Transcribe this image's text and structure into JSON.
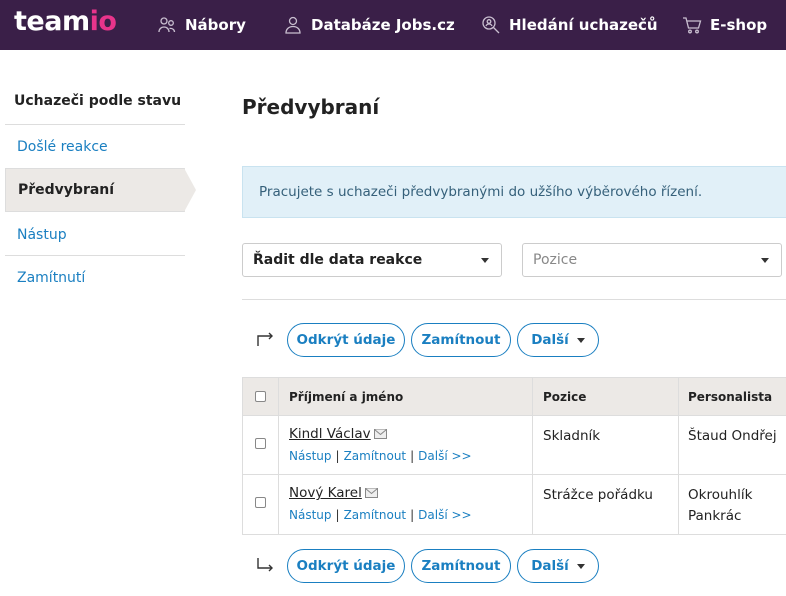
{
  "brand": {
    "logo_main": "team",
    "logo_accent": "io"
  },
  "nav": {
    "items": [
      {
        "label": "Nábory",
        "icon": "people-icon"
      },
      {
        "label": "Databáze Jobs.cz",
        "icon": "person-icon"
      },
      {
        "label": "Hledání uchazečů",
        "icon": "search-person-icon"
      },
      {
        "label": "E-shop",
        "icon": "cart-icon"
      }
    ]
  },
  "sidebar": {
    "title": "Uchazeči podle stavu",
    "items": [
      {
        "label": "Došlé reakce",
        "active": false
      },
      {
        "label": "Předvybraní",
        "active": true
      },
      {
        "label": "Nástup",
        "active": false
      },
      {
        "label": "Zamítnutí",
        "active": false
      }
    ]
  },
  "main": {
    "title": "Předvybraní",
    "info": "Pracujete s uchazeči předvybranými do užšího výběrového řízení.",
    "sort_select": "Řadit dle data reakce",
    "position_placeholder": "Pozice"
  },
  "toolbar": {
    "reveal_label": "Odkrýt údaje",
    "reject_label": "Zamítnout",
    "more_label": "Další"
  },
  "table": {
    "columns": [
      "Příjmení a jméno",
      "Pozice",
      "Personalista"
    ],
    "rows": [
      {
        "name": "Kindl Václav",
        "position": "Skladník",
        "recruiter_line1": "Štaud Ondřej",
        "recruiter_line2": "",
        "actions": [
          "Nástup",
          "Zamítnout",
          "Další >>"
        ]
      },
      {
        "name": "Nový Karel",
        "position": "Strážce pořádku",
        "recruiter_line1": "Okrouhlík",
        "recruiter_line2": "Pankrác",
        "actions": [
          "Nástup",
          "Zamítnout",
          "Další >>"
        ]
      }
    ]
  },
  "colors": {
    "topbar": "#3a1f48",
    "accent": "#e8348b",
    "link": "#1a7fc1",
    "info_bg": "#e1f0f8"
  }
}
